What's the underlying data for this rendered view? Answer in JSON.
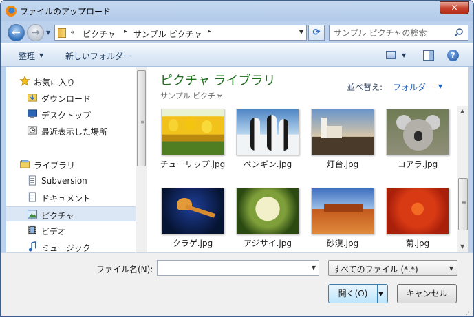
{
  "window": {
    "title": "ファイルのアップロード",
    "close_label": "✕"
  },
  "nav": {
    "back": "←",
    "forward": "→",
    "history": "▼",
    "refresh": "⟳"
  },
  "address": {
    "chevron": "«",
    "segments": [
      "ピクチャ",
      "サンプル ピクチャ"
    ],
    "separator": "▸",
    "dropdown": "▼"
  },
  "search": {
    "placeholder": "サンプル ピクチャの検索"
  },
  "toolbar": {
    "organize": "整理",
    "new_folder": "新しいフォルダー",
    "dropdown": "▼",
    "help": "?"
  },
  "sidebar": {
    "items": [
      {
        "label": "お気に入り",
        "icon": "star-icon"
      },
      {
        "label": "ダウンロード",
        "icon": "download-folder-icon"
      },
      {
        "label": "デスクトップ",
        "icon": "desktop-icon"
      },
      {
        "label": "最近表示した場所",
        "icon": "recent-places-icon"
      },
      {
        "label": "ライブラリ",
        "icon": "library-icon"
      },
      {
        "label": "Subversion",
        "icon": "document-library-icon"
      },
      {
        "label": "ドキュメント",
        "icon": "documents-icon"
      },
      {
        "label": "ピクチャ",
        "icon": "pictures-icon"
      },
      {
        "label": "ビデオ",
        "icon": "videos-icon"
      },
      {
        "label": "ミュージック",
        "icon": "music-icon"
      }
    ],
    "selected": "ピクチャ"
  },
  "content": {
    "title": "ピクチャ ライブラリ",
    "subtitle": "サンプル ピクチャ",
    "sort_label": "並べ替え:",
    "sort_value": "フォルダー",
    "files": [
      {
        "name": "チューリップ.jpg",
        "icon": "tulips-thumbnail"
      },
      {
        "name": "ペンギン.jpg",
        "icon": "penguins-thumbnail"
      },
      {
        "name": "灯台.jpg",
        "icon": "lighthouse-thumbnail"
      },
      {
        "name": "コアラ.jpg",
        "icon": "koala-thumbnail"
      },
      {
        "name": "クラゲ.jpg",
        "icon": "jellyfish-thumbnail"
      },
      {
        "name": "アジサイ.jpg",
        "icon": "hydrangeas-thumbnail"
      },
      {
        "name": "砂漠.jpg",
        "icon": "desert-thumbnail"
      },
      {
        "name": "菊.jpg",
        "icon": "chrysanthemum-thumbnail"
      }
    ]
  },
  "footer": {
    "filename_label": "ファイル名(N):",
    "filename_value": "",
    "filter": "すべてのファイル (*.*)",
    "open": "開く(O)",
    "cancel": "キャンセル"
  },
  "colors": {
    "title_green": "#1e6f1e",
    "link_blue": "#1b5ebe",
    "selection": "#dbe7f5"
  }
}
